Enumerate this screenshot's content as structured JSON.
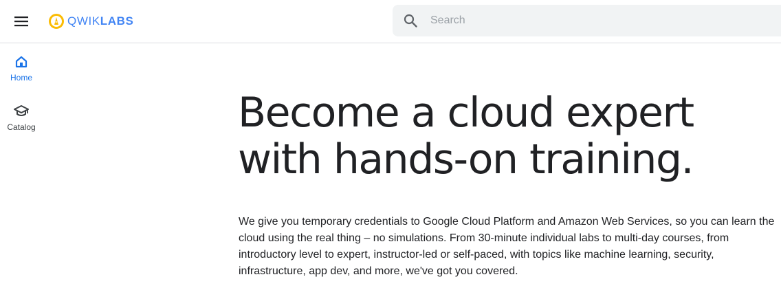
{
  "header": {
    "menu_icon": "hamburger-menu-icon",
    "logo": {
      "icon": "qwiklabs-logo-icon",
      "text_light": "QWIK",
      "text_bold": "LABS",
      "color": "#4285f4",
      "mark_color": "#fbbc04"
    },
    "search": {
      "icon": "search-icon",
      "placeholder": "Search"
    }
  },
  "sidebar": {
    "items": [
      {
        "label": "Home",
        "icon": "home-icon",
        "active": true,
        "color": "#1a73e8"
      },
      {
        "label": "Catalog",
        "icon": "graduation-cap-icon",
        "active": false,
        "color": "#3c4043"
      }
    ]
  },
  "hero": {
    "title": "Become a cloud expert with hands-on training.",
    "body": "We give you temporary credentials to Google Cloud Platform and Amazon Web Services, so you can learn the cloud using the real thing – no simulations. From 30-minute individual labs to multi-day courses, from introductory level to expert, instructor-led or self-paced, with topics like machine learning, security, infrastructure, app dev, and more, we've got you covered."
  }
}
